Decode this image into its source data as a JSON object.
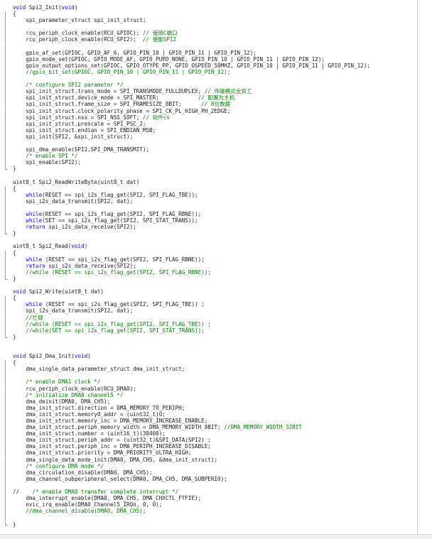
{
  "editor": {
    "language": "C",
    "colors": {
      "keyword": "#0000ff",
      "comment": "#008000",
      "text": "#1c1c1c"
    },
    "lines": [
      [
        [
          "void",
          "kw"
        ],
        [
          " Spi2_Init("
        ],
        [
          "void",
          "kw"
        ],
        [
          ")"
        ]
      ],
      [
        [
          "{"
        ]
      ],
      [
        [
          "    spi_parameter_struct spi_init_struct;"
        ]
      ],
      [
        [
          ""
        ]
      ],
      [
        [
          "    rcu_periph_clock_enable(RCU_GPIOC); "
        ],
        [
          "// 使用C端口",
          "cm"
        ]
      ],
      [
        [
          "    rcu_periph_clock_enable(RCU_SPI2);  "
        ],
        [
          "// 使能SPI2",
          "cm"
        ]
      ],
      [
        [
          ""
        ]
      ],
      [
        [
          "    gpio_af_set(GPIOC, GPIO_AF_6, GPIO_PIN_10 | GPIO_PIN_11 | GPIO_PIN_12);"
        ]
      ],
      [
        [
          "    gpio_mode_set(GPIOC, GPIO_MODE_AF, GPIO_PUPD_NONE, GPIO_PIN_10 | GPIO_PIN_11 | GPIO_PIN_12);"
        ]
      ],
      [
        [
          "    gpio_output_options_set(GPIOC, GPIO_OTYPE_PP, GPIO_OSPEED_50MHZ, GPIO_PIN_10 | GPIO_PIN_11 | GPIO_PIN_12);"
        ]
      ],
      [
        [
          "    "
        ],
        [
          "//gpio_bit_set(GPIOC, GPIO_PIN_10 | GPIO_PIN_11 | GPIO_PIN_12);",
          "cm"
        ]
      ],
      [
        [
          ""
        ]
      ],
      [
        [
          "    "
        ],
        [
          "/* configure SPI2 parameter */",
          "cm"
        ]
      ],
      [
        [
          "    spi_init_struct.trans_mode = SPI_TRANSMODE_FULLDUPLEX; "
        ],
        [
          "// 传输模式全双工",
          "cm"
        ]
      ],
      [
        [
          "    spi_init_struct.device_mode = SPI_MASTER;            "
        ],
        [
          "// 配置为主机",
          "cm"
        ]
      ],
      [
        [
          "    spi_init_struct.frame_size = SPI_FRAMESIZE_8BIT;      "
        ],
        [
          "// 8位数据",
          "cm"
        ]
      ],
      [
        [
          "    spi_init_struct.clock_polarity_phase = SPI_CK_PL_HIGH_PH_2EDGE;"
        ]
      ],
      [
        [
          "    spi_init_struct.nss = SPI_NSS_SOFT; "
        ],
        [
          "// 软件cs",
          "cm"
        ]
      ],
      [
        [
          "    spi_init_struct.prescale = SPI_PSC_2;"
        ]
      ],
      [
        [
          "    spi_init_struct.endian = SPI_ENDIAN_MSB;"
        ]
      ],
      [
        [
          "    spi_init(SPI2, &spi_init_struct);"
        ]
      ],
      [
        [
          ""
        ]
      ],
      [
        [
          "    spi_dma_enable(SPI2,SPI_DMA_TRANSMIT);"
        ]
      ],
      [
        [
          "    "
        ],
        [
          "/* enable SPI */",
          "cm"
        ]
      ],
      [
        [
          "    spi_enable(SPI2);"
        ]
      ],
      [
        [
          "}"
        ]
      ],
      [
        [
          ""
        ]
      ],
      [
        [
          "uint8_t Spi2_ReadWriteByte(uint8_t dat)"
        ]
      ],
      [
        [
          "{"
        ]
      ],
      [
        [
          "    "
        ],
        [
          "while",
          "kw"
        ],
        [
          "(RESET == spi_i2s_flag_get(SPI2, SPI_FLAG_TBE));"
        ]
      ],
      [
        [
          "    spi_i2s_data_transmit(SPI2, dat);"
        ]
      ],
      [
        [
          ""
        ]
      ],
      [
        [
          "    "
        ],
        [
          "while",
          "kw"
        ],
        [
          "(RESET == spi_i2s_flag_get(SPI2, SPI_FLAG_RBNE));"
        ]
      ],
      [
        [
          "    "
        ],
        [
          "while",
          "kw"
        ],
        [
          "(SET == spi_i2s_flag_get(SPI2, SPI_STAT_TRANS));"
        ]
      ],
      [
        [
          "    "
        ],
        [
          "return",
          "kw"
        ],
        [
          " spi_i2s_data_receive(SPI2);"
        ]
      ],
      [
        [
          "}"
        ]
      ],
      [
        [
          ""
        ]
      ],
      [
        [
          "uint8_t Spi2_Read("
        ],
        [
          "void",
          "kw"
        ],
        [
          ")"
        ]
      ],
      [
        [
          "{"
        ]
      ],
      [
        [
          "    "
        ],
        [
          "while",
          "kw"
        ],
        [
          " (RESET == spi_i2s_flag_get(SPI2, SPI_FLAG_RBNE));"
        ]
      ],
      [
        [
          "    "
        ],
        [
          "return",
          "kw"
        ],
        [
          " spi_i2s_data_receive(SPI2);"
        ]
      ],
      [
        [
          "    "
        ],
        [
          "//while (RESET == spi_i2s_flag_get(SPI2, SPI_FLAG_RBNE));",
          "cm"
        ]
      ],
      [
        [
          "}"
        ]
      ],
      [
        [
          ""
        ]
      ],
      [
        [
          "void",
          "kw"
        ],
        [
          " Spi2_Write(uint8_t dat)"
        ]
      ],
      [
        [
          "{"
        ]
      ],
      [
        [
          "    "
        ],
        [
          "while",
          "kw"
        ],
        [
          " (RESET == spi_i2s_flag_get(SPI2, SPI_FLAG_TBE)) ;"
        ]
      ],
      [
        [
          "    spi_i2s_data_transmit(SPI2, dat);"
        ]
      ],
      [
        [
          "    "
        ],
        [
          "//忙碌",
          "cm"
        ]
      ],
      [
        [
          "    "
        ],
        [
          "//while (RESET == spi_i2s_flag_get(SPI2, SPI_FLAG_TBE)) ;",
          "cm"
        ]
      ],
      [
        [
          "    "
        ],
        [
          "//while(SET == spi_i2s_flag_get(SPI2, SPI_STAT_TRANS));",
          "cm"
        ]
      ],
      [
        [
          "}"
        ]
      ],
      [
        [
          ""
        ]
      ],
      [
        [
          ""
        ]
      ],
      [
        [
          "void",
          "kw"
        ],
        [
          " Spi2_Dma_Init("
        ],
        [
          "void",
          "kw"
        ],
        [
          ")"
        ]
      ],
      [
        [
          "{"
        ]
      ],
      [
        [
          "    dma_single_data_parameter_struct dma_init_struct;"
        ]
      ],
      [
        [
          ""
        ]
      ],
      [
        [
          "    "
        ],
        [
          "/* enable DMA1 clock */",
          "cm"
        ]
      ],
      [
        [
          "    rcu_periph_clock_enable(RCU_DMA0);"
        ]
      ],
      [
        [
          "    "
        ],
        [
          "/* initialize DMA0 channel5 */",
          "cm"
        ]
      ],
      [
        [
          "    dma_deinit(DMA0, DMA_CH5);"
        ]
      ],
      [
        [
          "    dma_init_struct.direction = DMA_MEMORY_TO_PERIPH;"
        ]
      ],
      [
        [
          "    dma_init_struct.memory0_addr = (uint32_t)0;"
        ]
      ],
      [
        [
          "    dma_init_struct.memory_inc = DMA_MEMORY_INCREASE_ENABLE;"
        ]
      ],
      [
        [
          "    dma_init_struct.periph_memory_width = DMA_MEMORY_WIDTH_8BIT; "
        ],
        [
          "//DMA_MEMORY_WIDTH_32BIT",
          "cm"
        ]
      ],
      [
        [
          "    dma_init_struct.number = (uint16_t)(38400);"
        ]
      ],
      [
        [
          "    dma_init_struct.periph_addr = (uint32_t)&SPI_DATA(SPI2) ;"
        ]
      ],
      [
        [
          "    dma_init_struct.periph_inc = DMA_PERIPH_INCREASE_DISABLE;"
        ]
      ],
      [
        [
          "    dma_init_struct.priority = DMA_PRIORITY_ULTRA_HIGH;"
        ]
      ],
      [
        [
          "    dma_single_data_mode_init(DMA0, DMA_CH5, &dma_init_struct);"
        ]
      ],
      [
        [
          "    "
        ],
        [
          "/* configure DMA mode */",
          "cm"
        ]
      ],
      [
        [
          "    dma_circulation_disable(DMA0, DMA_CH5);"
        ]
      ],
      [
        [
          "    dma_channel_subperipheral_select(DMA0, DMA_CH5, DMA_SUBPERI0);"
        ]
      ],
      [
        [
          ""
        ]
      ],
      [
        [
          "//    "
        ],
        [
          "/* enable DMA0 transfer complete interrupt */",
          "cm"
        ]
      ],
      [
        [
          "    dma_interrupt_enable(DMA0, DMA_CH5, DMA_CHXCTL_FTFIE);"
        ]
      ],
      [
        [
          "    nvic_irq_enable(DMA0_Channel5_IRQn, 0, 0);"
        ]
      ],
      [
        [
          "    "
        ],
        [
          "//dma_channel_disable(DMA0, DMA_CH5);",
          "cm"
        ]
      ],
      [
        [
          ""
        ]
      ],
      [
        [
          "}"
        ]
      ]
    ]
  }
}
